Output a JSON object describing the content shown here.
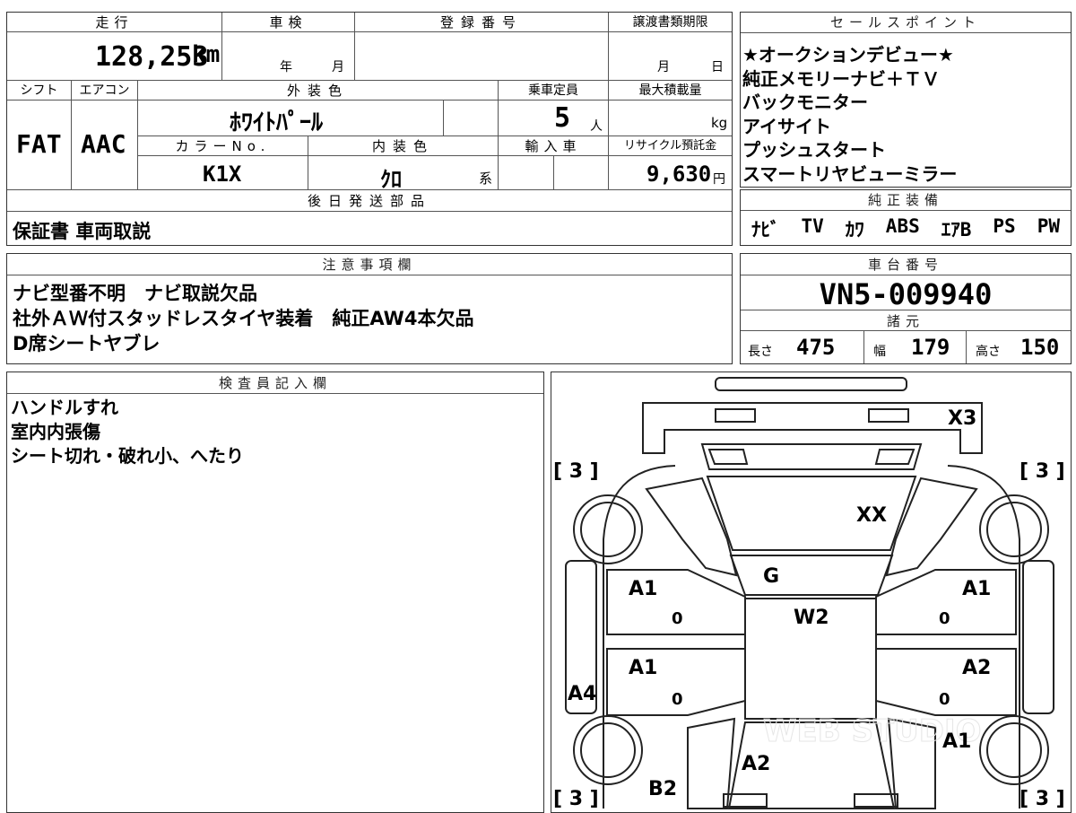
{
  "vehicle": {
    "mileage_label": "走行",
    "mileage": "128,253",
    "mileage_unit": "km",
    "inspection_label": "車検",
    "year_unit": "年",
    "month_unit": "月",
    "registration_label": "登録番号",
    "transfer_label": "譲渡書類期限",
    "transfer_month": "月",
    "transfer_day": "日",
    "shift_label": "シフト",
    "shift": "FAT",
    "aircon_label": "エアコン",
    "aircon": "AAC",
    "exterior_label": "外装色",
    "exterior": "ﾎﾜｲﾄﾊﾟｰﾙ",
    "capacity_label": "乗車定員",
    "capacity": "5",
    "capacity_unit": "人",
    "maxload_label": "最大積載量",
    "maxload_unit": "kg",
    "colorno_label": "カラーNo.",
    "colorno": "K1X",
    "interior_label": "内装色",
    "interior": "ｸﾛ",
    "interior_suffix": "系",
    "import_label": "輸入車",
    "recycle_label": "リサイクル預託金",
    "recycle": "9,630",
    "recycle_unit": "円",
    "later_parts_label": "後日発送部品",
    "later_parts": "保証書 車両取説"
  },
  "sales_points": {
    "label": "セールスポイント",
    "items": [
      "★オークションデビュー★",
      "純正メモリーナビ＋ＴＶ",
      "バックモニター",
      "アイサイト",
      "プッシュスタート",
      "スマートリヤビューミラー"
    ]
  },
  "equipment": {
    "label": "純正装備",
    "items": [
      "ﾅﾋﾞ",
      "TV",
      "ｶﾜ",
      "ABS",
      "ｴｱB",
      "PS",
      "PW"
    ]
  },
  "notes": {
    "label": "注意事項欄",
    "lines": [
      "ナビ型番不明　ナビ取説欠品",
      "社外ＡＷ付スタッドレスタイヤ装着　純正AW4本欠品",
      "D席シートヤブレ"
    ]
  },
  "chassis": {
    "label": "車台番号",
    "number": "VN5-009940",
    "spec_label": "諸元",
    "length_label": "長さ",
    "length": "475",
    "width_label": "幅",
    "width": "179",
    "height_label": "高さ",
    "height": "150"
  },
  "inspector": {
    "label": "検査員記入欄",
    "lines": [
      "ハンドルすれ",
      "室内内張傷",
      "シート切れ・破れ小、へたり"
    ]
  },
  "diagram": {
    "tire_fl": "[ 3 ]",
    "tire_fr": "[ 3 ]",
    "tire_rl": "[ 3 ]",
    "tire_rr": "[ 3 ]",
    "front_mark": "X3",
    "hood": "XX",
    "windshield": "G",
    "roof": "W2",
    "fl_fender": "A1",
    "fl_fender_sub": "0",
    "fr_fender": "A1",
    "fr_fender_sub": "0",
    "rl_door": "A1",
    "rl_door_sub": "0",
    "rr_door": "A2",
    "rr_door_sub": "0",
    "left_sill": "A4",
    "rr_quarter": "A1",
    "trunk": "A2",
    "rear_bumper": "B2",
    "watermark": "WEB STUDIO"
  }
}
